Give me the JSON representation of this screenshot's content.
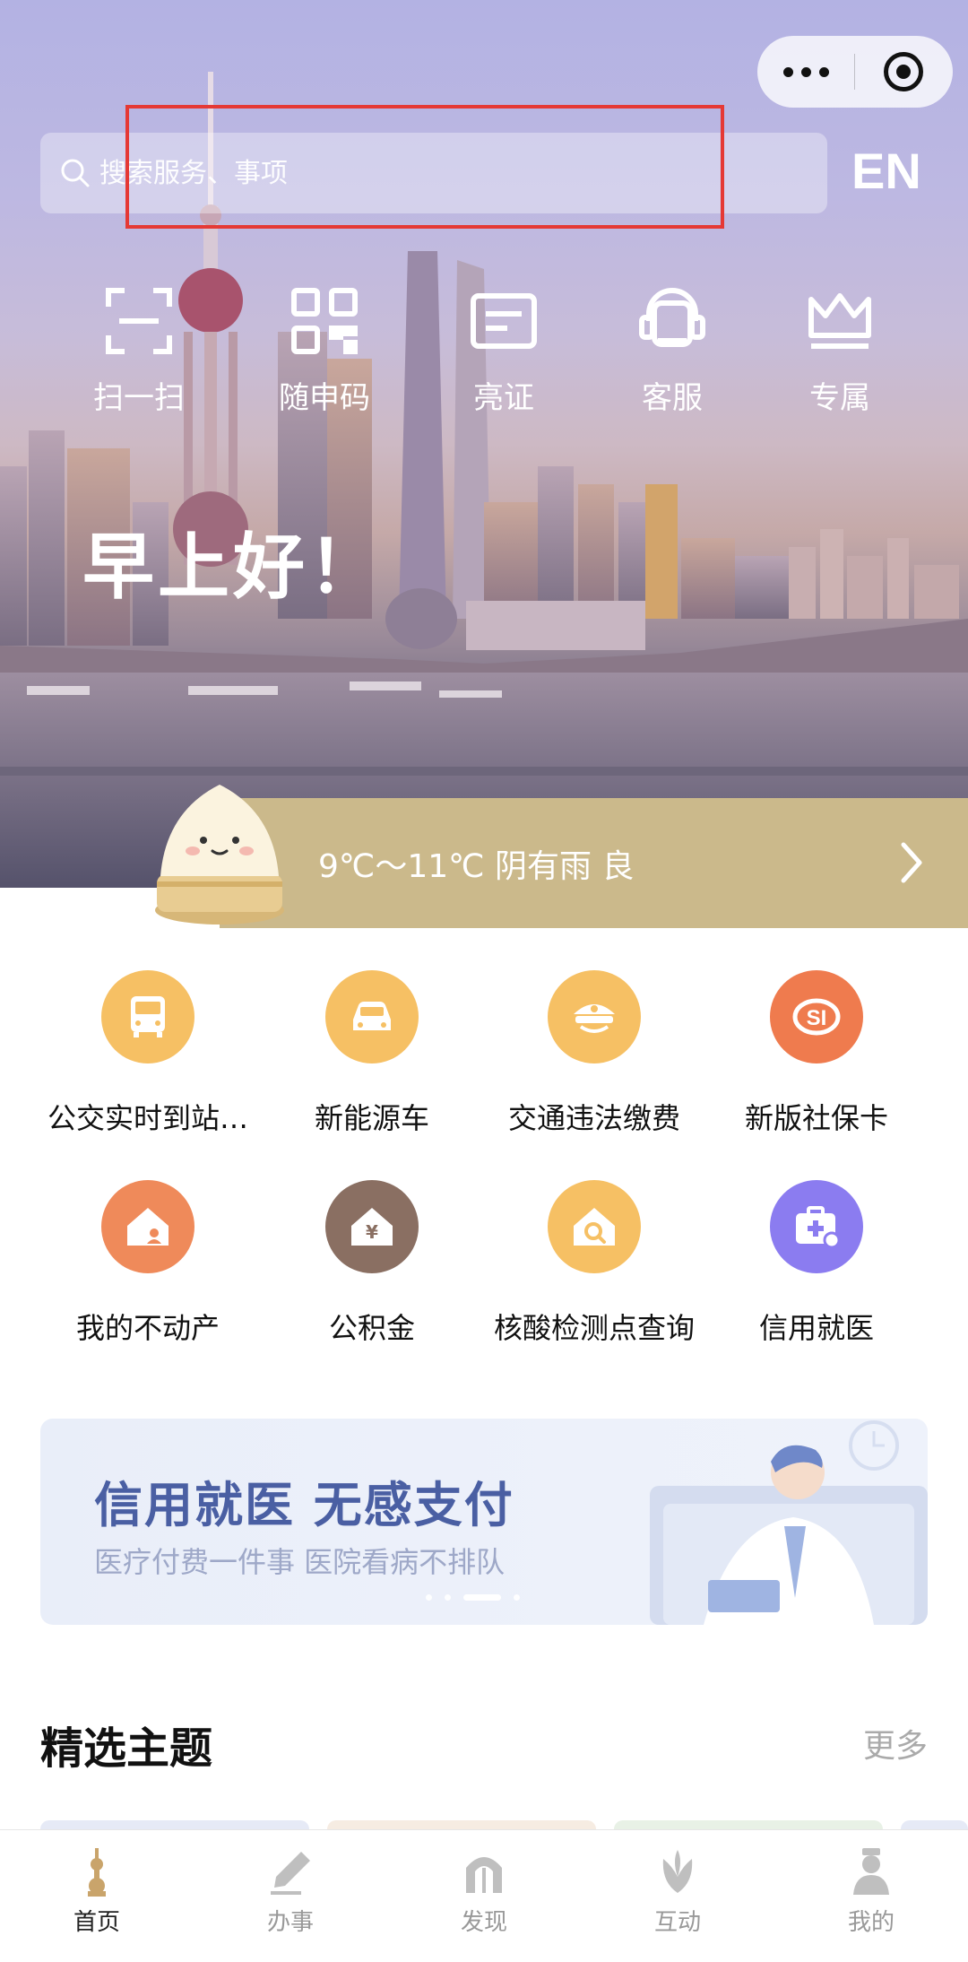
{
  "header": {
    "search_placeholder": "搜索服务、事项",
    "lang_button": "EN"
  },
  "quick_actions": [
    {
      "label": "扫一扫",
      "icon": "scan-icon"
    },
    {
      "label": "随申码",
      "icon": "qr-code-icon"
    },
    {
      "label": "亮证",
      "icon": "id-card-icon"
    },
    {
      "label": "客服",
      "icon": "customer-service-icon"
    },
    {
      "label": "专属",
      "icon": "crown-icon"
    }
  ],
  "greeting": "早上好！",
  "weather": {
    "text": "9℃～11℃ 阴有雨 良"
  },
  "services": [
    {
      "label": "公交实时到站…",
      "icon": "bus-icon",
      "color": "#f6c064"
    },
    {
      "label": "新能源车",
      "icon": "car-icon",
      "color": "#f6c064"
    },
    {
      "label": "交通违法缴费",
      "icon": "police-cap-icon",
      "color": "#f6c064"
    },
    {
      "label": "新版社保卡",
      "icon": "social-security-icon",
      "color": "#ef7b4e"
    },
    {
      "label": "我的不动产",
      "icon": "house-icon",
      "color": "#ef8a5a"
    },
    {
      "label": "公积金",
      "icon": "fund-icon",
      "color": "#8a6f62"
    },
    {
      "label": "核酸检测点查询",
      "icon": "test-site-icon",
      "color": "#f6c064"
    },
    {
      "label": "信用就医",
      "icon": "medical-kit-icon",
      "color": "#8b7cf0"
    }
  ],
  "banner": {
    "title": "信用就医  无感支付",
    "subtitle": "医疗付费一件事 医院看病不排队"
  },
  "section": {
    "title": "精选主题",
    "more": "更多"
  },
  "tabs": [
    {
      "label": "首页",
      "icon": "pearl-tower-icon",
      "active": true
    },
    {
      "label": "办事",
      "icon": "pen-icon",
      "active": false
    },
    {
      "label": "发现",
      "icon": "arch-icon",
      "active": false
    },
    {
      "label": "互动",
      "icon": "magnolia-icon",
      "active": false
    },
    {
      "label": "我的",
      "icon": "person-icon",
      "active": false
    }
  ]
}
